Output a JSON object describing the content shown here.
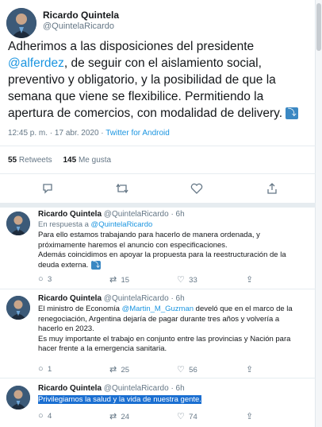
{
  "main_tweet": {
    "name": "Ricardo Quintela",
    "handle": "@QuintelaRicardo",
    "text_before": "Adherimos a las disposiciones del presidente ",
    "mention": "@alferdez",
    "text_after": ", de seguir con el aislamiento social, preventivo y obligatorio, y la posibilidad de que la semana que viene se flexibilice. Permitiendo la apertura de comercios, con modalidad de delivery.",
    "time": "12:45 p. m. · 17 abr. 2020 · ",
    "source": "Twitter for Android",
    "retweets_count": "55",
    "retweets_label": "Retweets",
    "likes_count": "145",
    "likes_label": "Me gusta"
  },
  "replies": [
    {
      "name": "Ricardo Quintela",
      "handle": "@QuintelaRicardo",
      "age": "· 6h",
      "in_reply_prefix": "En respuesta a ",
      "in_reply_handle": "@QuintelaRicardo",
      "line1": "Para ello estamos trabajando para hacerlo de manera ordenada, y",
      "line2": "próximamente haremos el anuncio con especificaciones.",
      "line3": "Además coincidimos en apoyar la propuesta para la reestructuración de la",
      "line4": "deuda externa.",
      "replies": "3",
      "retweets": "15",
      "likes": "33"
    },
    {
      "name": "Ricardo Quintela",
      "handle": "@QuintelaRicardo",
      "age": "· 6h",
      "line1_before": "El ministro de Economía ",
      "line1_mention": "@Martin_M_Guzman",
      "line1_after": " develó que en el marco de la",
      "line2": "renegociación, Argentina dejaría de pagar durante tres años y volvería a",
      "line3": "hacerlo en 2023.",
      "line4": "Es muy importante el trabajo en conjunto entre las provincias y Nación para",
      "line5": "hacer frente a la emergencia sanitaria.",
      "replies": "1",
      "retweets": "25",
      "likes": "56"
    },
    {
      "name": "Ricardo Quintela",
      "handle": "@QuintelaRicardo",
      "age": "· 6h",
      "line1": "Privilegiamos la salud  y la vida de nuestra gente.",
      "replies": "4",
      "retweets": "24",
      "likes": "74"
    }
  ],
  "icons": {
    "reply": "speech-bubble",
    "retweet": "arrows-loop",
    "like": "heart",
    "share": "upload"
  },
  "colors": {
    "link": "#1b95e0",
    "muted": "#657786",
    "highlight": "#1b6fd1"
  }
}
